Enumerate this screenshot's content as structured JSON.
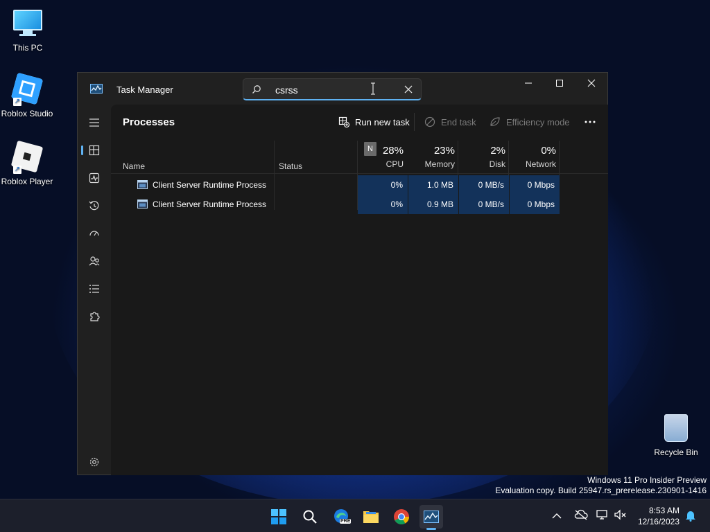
{
  "desktop": {
    "icons": [
      {
        "label": "This PC"
      },
      {
        "label": "Roblox Studio"
      },
      {
        "label": "Roblox Player"
      },
      {
        "label": "Recycle Bin"
      }
    ],
    "watermark_line1": "Windows 11 Pro Insider Preview",
    "watermark_line2": "Evaluation copy. Build 25947.rs_prerelease.230901-1416"
  },
  "window": {
    "title": "Task Manager",
    "search": {
      "value": "csrss",
      "placeholder": ""
    }
  },
  "toolbar": {
    "page_title": "Processes",
    "run_new_task": "Run new task",
    "end_task": "End task",
    "efficiency_mode": "Efficiency mode"
  },
  "table": {
    "headers": {
      "name": "Name",
      "status": "Status",
      "cpu_pct": "28%",
      "cpu": "CPU",
      "memory_pct": "23%",
      "memory": "Memory",
      "disk_pct": "2%",
      "disk": "Disk",
      "network_pct": "0%",
      "network": "Network",
      "badge": "N"
    },
    "rows": [
      {
        "name": "Client Server Runtime Process",
        "cpu": "0%",
        "memory": "1.0 MB",
        "disk": "0 MB/s",
        "network": "0 Mbps"
      },
      {
        "name": "Client Server Runtime Process",
        "cpu": "0%",
        "memory": "0.9 MB",
        "disk": "0 MB/s",
        "network": "0 Mbps"
      }
    ]
  },
  "taskbar": {
    "time": "8:53 AM",
    "date": "12/16/2023",
    "edge_badge": "PRE"
  },
  "colors": {
    "accent": "#5fb2f2",
    "highlight_cell": "#13325a",
    "window_bg": "#202020"
  }
}
